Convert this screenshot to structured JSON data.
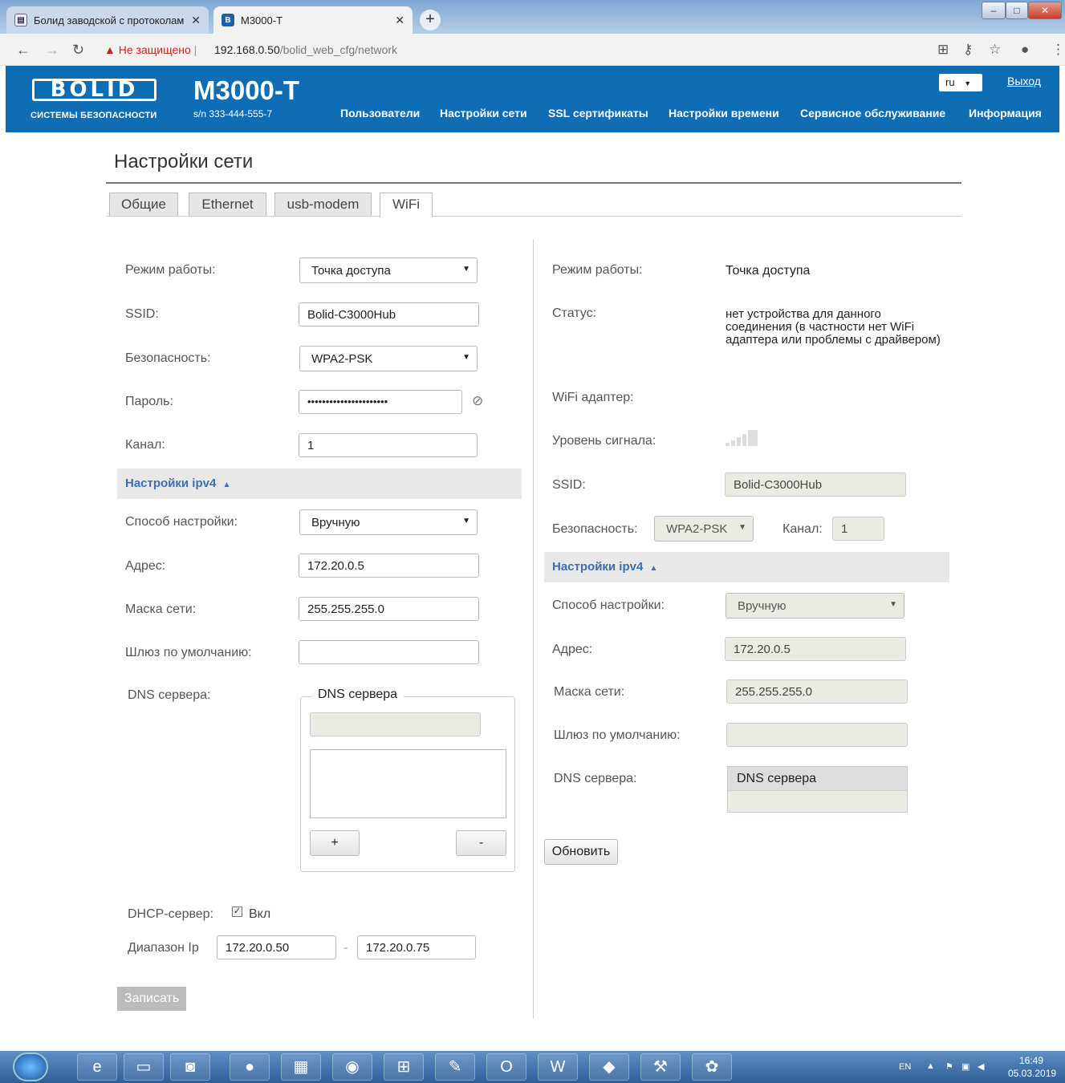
{
  "browser": {
    "tabs": [
      {
        "title": "Болид заводской с протоколам",
        "icon": "document-icon"
      },
      {
        "title": "M3000-T",
        "icon": "bolid-favicon"
      }
    ],
    "favicon_letter": "B",
    "new_tab": "+",
    "insecure_label": "Не защищено",
    "url_host": "192.168.0.50",
    "url_path": "/bolid_web_cfg/network"
  },
  "header": {
    "logo_text": "BOLID",
    "logo_tagline": "СИСТЕМЫ БЕЗОПАСНОСТИ",
    "device_name": "M3000-T",
    "serial": "s/n 333-444-555-7",
    "nav": [
      "Пользователи",
      "Настройки сети",
      "SSL сертификаты",
      "Настройки времени",
      "Сервисное обслуживание",
      "Информация"
    ],
    "language": "ru",
    "logout": "Выход"
  },
  "page": {
    "title": "Настройки сети",
    "tabs": [
      "Общие",
      "Ethernet",
      "usb-modem",
      "WiFi"
    ],
    "active_tab": "WiFi"
  },
  "form": {
    "mode_label": "Режим работы:",
    "mode_value": "Точка доступа",
    "ssid_label": "SSID:",
    "ssid_value": "Bolid-C3000Hub",
    "security_label": "Безопасность:",
    "security_value": "WPA2-PSK",
    "password_label": "Пароль:",
    "password_value": "••••••••••••••••••••••",
    "channel_label": "Канал:",
    "channel_value": "1",
    "ipv4_section": "Настройки ipv4",
    "method_label": "Способ настройки:",
    "method_value": "Вручную",
    "address_label": "Адрес:",
    "address_value": "172.20.0.5",
    "mask_label": "Маска сети:",
    "mask_value": "255.255.255.0",
    "gateway_label": "Шлюз по умолчанию:",
    "gateway_value": "",
    "dns_label": "DNS сервера:",
    "dns_legend": "DNS сервера",
    "dns_add": "+",
    "dns_remove": "-",
    "dhcp_label": "DHCP-сервер:",
    "dhcp_checkbox": "Вкл",
    "dhcp_checked": true,
    "range_label": "Диапазон Ip",
    "range_from": "172.20.0.50",
    "range_sep": "-",
    "range_to": "172.20.0.75",
    "write_button": "Записать"
  },
  "status": {
    "mode_label": "Режим работы:",
    "mode_value": "Точка доступа",
    "status_label": "Статус:",
    "status_value": "нет устройства для данного соединения (в частности нет WiFi адаптера или проблемы с драйвером)",
    "adapter_label": "WiFi адаптер:",
    "signal_label": "Уровень сигнала:",
    "signal_bars": 0,
    "ssid_label": "SSID:",
    "ssid_value": "Bolid-C3000Hub",
    "security_label": "Безопасность:",
    "security_value": "WPA2-PSK",
    "channel_label": "Канал:",
    "channel_value": "1",
    "ipv4_section": "Настройки ipv4",
    "method_label": "Способ настройки:",
    "method_value": "Вручную",
    "address_label": "Адрес:",
    "address_value": "172.20.0.5",
    "mask_label": "Маска сети:",
    "mask_value": "255.255.255.0",
    "gateway_label": "Шлюз по умолчанию:",
    "gateway_value": "",
    "dns_label": "DNS сервера:",
    "dns_header": "DNS сервера",
    "refresh_button": "Обновить"
  },
  "taskbar": {
    "lang": "EN",
    "time": "16:49",
    "date": "05.03.2019"
  },
  "colors": {
    "brand": "#0e6db5",
    "section_text": "#3a6fb0",
    "insecure": "#c5221f"
  }
}
